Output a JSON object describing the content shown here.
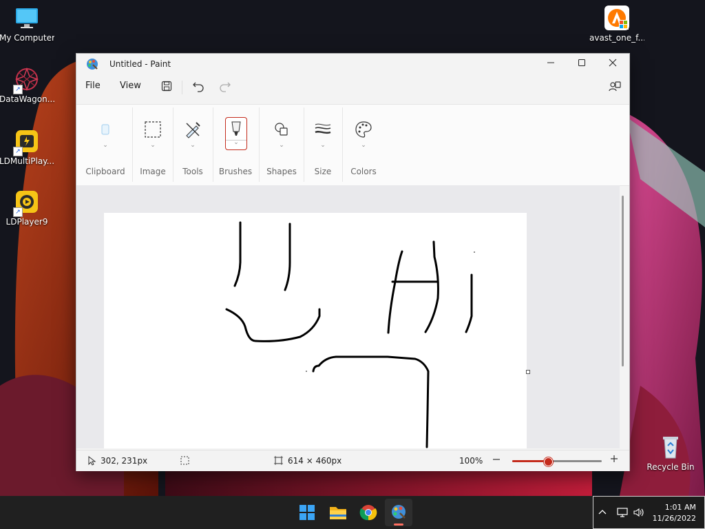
{
  "desktop": {
    "icons": [
      {
        "label": "My Computer"
      },
      {
        "label": "DataWagon..."
      },
      {
        "label": "LDMultiPlay..."
      },
      {
        "label": "LDPlayer9"
      },
      {
        "label": "avast_one_f..."
      },
      {
        "label": "Recycle Bin"
      }
    ]
  },
  "window": {
    "title": "Untitled - Paint",
    "menu": {
      "file": "File",
      "view": "View"
    },
    "ribbon": {
      "groups": [
        {
          "label": "Clipboard",
          "icon": "clipboard-icon"
        },
        {
          "label": "Image",
          "icon": "select-icon"
        },
        {
          "label": "Tools",
          "icon": "tools-icon"
        },
        {
          "label": "Brushes",
          "icon": "brush-icon"
        },
        {
          "label": "Shapes",
          "icon": "shapes-icon"
        },
        {
          "label": "Size",
          "icon": "size-icon"
        },
        {
          "label": "Colors",
          "icon": "palette-icon"
        }
      ]
    },
    "status": {
      "cursor_pos": "302, 231px",
      "canvas_size": "614 × 460px",
      "zoom": "100%",
      "zoom_level": 0.4
    }
  },
  "taskbar": {
    "apps": [
      "start-icon",
      "file-explorer-icon",
      "chrome-icon",
      "paint-icon"
    ],
    "clock_time": "1:01 AM",
    "clock_date": "11/26/2022"
  },
  "colors": {
    "accent": "#c42b1c",
    "taskbar": "#202020"
  }
}
